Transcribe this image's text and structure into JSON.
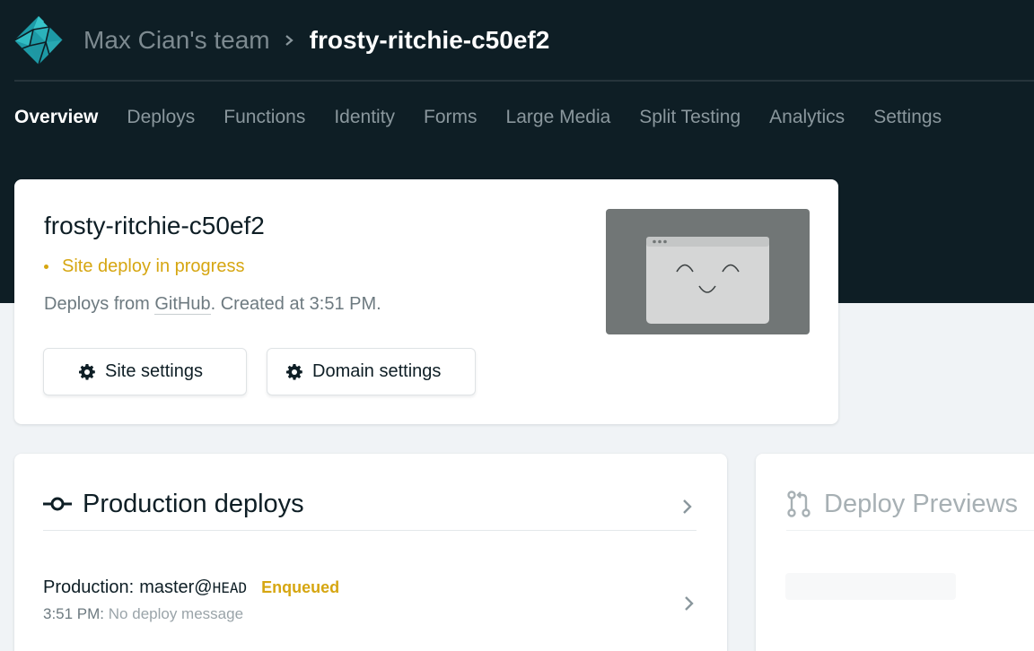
{
  "header": {
    "team": "Max Cian's team",
    "site_name": "frosty-ritchie-c50ef2"
  },
  "nav": {
    "items": [
      {
        "label": "Overview",
        "active": true
      },
      {
        "label": "Deploys"
      },
      {
        "label": "Functions"
      },
      {
        "label": "Identity"
      },
      {
        "label": "Forms"
      },
      {
        "label": "Large Media"
      },
      {
        "label": "Split Testing"
      },
      {
        "label": "Analytics"
      },
      {
        "label": "Settings"
      }
    ]
  },
  "site_card": {
    "title": "frosty-ritchie-c50ef2",
    "status": "Site deploy in progress",
    "meta_prefix": "Deploys from ",
    "meta_link": "GitHub",
    "meta_suffix": ". Created at 3:51 PM.",
    "site_settings_label": "Site settings",
    "domain_settings_label": "Domain settings"
  },
  "production": {
    "title": "Production deploys",
    "deploy": {
      "context": "Production",
      "branch": "master@",
      "ref": "HEAD",
      "status": "Enqueued",
      "time": "3:51 PM:",
      "message": "No deploy message"
    }
  },
  "previews": {
    "title": "Deploy Previews"
  },
  "colors": {
    "topbar": "#0e1e25",
    "accent_warning": "#d6a611",
    "brand_teal": "#20c6b7"
  },
  "icons": [
    "netlify-logo-icon",
    "chevron-right-icon",
    "gear-icon",
    "commit-icon",
    "pull-request-icon",
    "browser-smile-icon"
  ]
}
